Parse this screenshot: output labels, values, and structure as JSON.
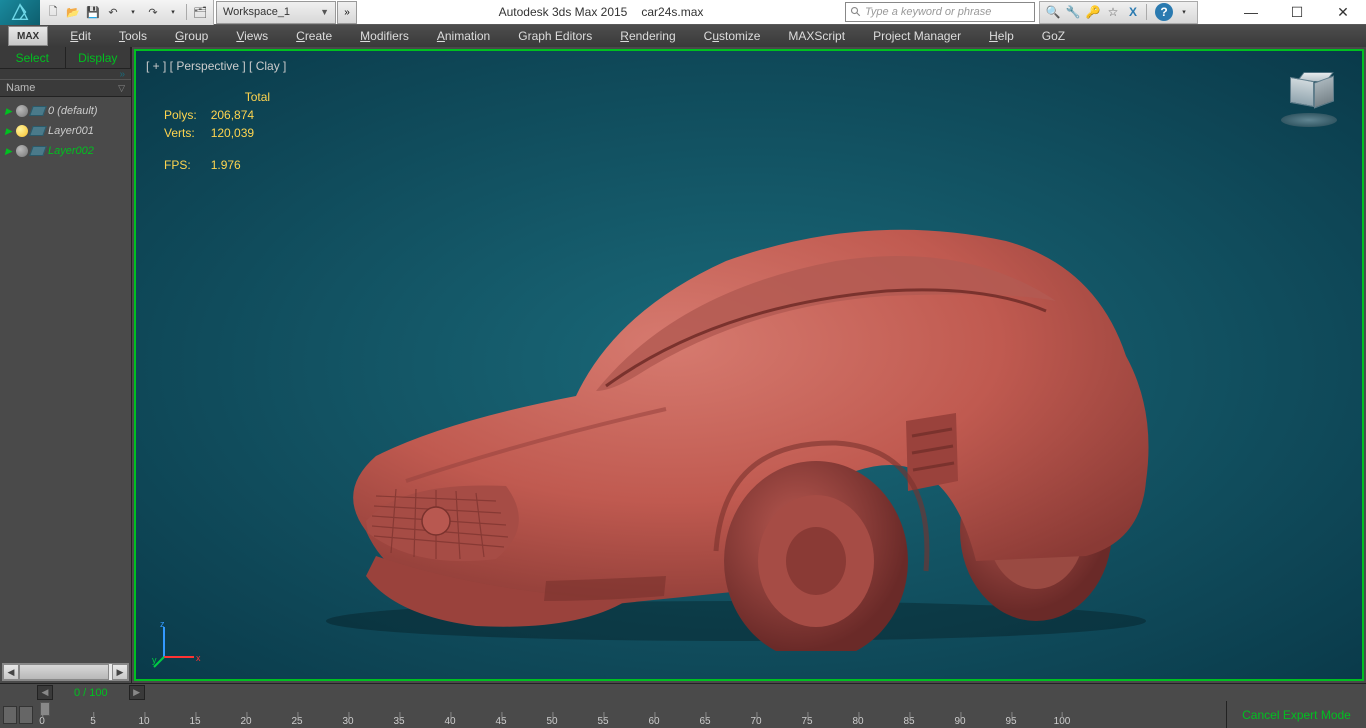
{
  "titlebar": {
    "workspace": "Workspace_1",
    "app_title": "Autodesk 3ds Max  2015",
    "filename": "car24s.max",
    "search_placeholder": "Type a keyword or phrase",
    "max_label": "MAX"
  },
  "menus": {
    "edit": "Edit",
    "tools": "Tools",
    "group": "Group",
    "views": "Views",
    "create": "Create",
    "modifiers": "Modifiers",
    "animation": "Animation",
    "graph": "Graph Editors",
    "rendering": "Rendering",
    "customize": "Customize",
    "maxscript": "MAXScript",
    "project": "Project Manager",
    "help": "Help",
    "goz": "GoZ"
  },
  "left_panel": {
    "tab_select": "Select",
    "tab_display": "Display",
    "header": "Name",
    "layers": [
      {
        "name": "0 (default)",
        "on": false,
        "active": false
      },
      {
        "name": "Layer001",
        "on": true,
        "active": false
      },
      {
        "name": "Layer002",
        "on": false,
        "active": true
      }
    ]
  },
  "viewport": {
    "label": "[ + ] [ Perspective ] [ Clay ]",
    "stats": {
      "total_hdr": "Total",
      "polys_lbl": "Polys:",
      "polys_val": "206,874",
      "verts_lbl": "Verts:",
      "verts_val": "120,039",
      "fps_lbl": "FPS:",
      "fps_val": "1.976"
    },
    "gizmo": {
      "x": "x",
      "y": "y",
      "z": "z"
    }
  },
  "timeline": {
    "frame": "0 / 100",
    "cancel": "Cancel Expert Mode",
    "ticks": [
      {
        "v": "0",
        "p": 0
      },
      {
        "v": "5",
        "p": 5
      },
      {
        "v": "10",
        "p": 10
      },
      {
        "v": "15",
        "p": 15
      },
      {
        "v": "20",
        "p": 20
      },
      {
        "v": "25",
        "p": 25
      },
      {
        "v": "30",
        "p": 30
      },
      {
        "v": "35",
        "p": 35
      },
      {
        "v": "40",
        "p": 40
      },
      {
        "v": "45",
        "p": 45
      },
      {
        "v": "50",
        "p": 50
      },
      {
        "v": "55",
        "p": 55
      },
      {
        "v": "60",
        "p": 60
      },
      {
        "v": "65",
        "p": 65
      },
      {
        "v": "70",
        "p": 70
      },
      {
        "v": "75",
        "p": 75
      },
      {
        "v": "80",
        "p": 80
      },
      {
        "v": "85",
        "p": 85
      },
      {
        "v": "90",
        "p": 90
      },
      {
        "v": "95",
        "p": 95
      },
      {
        "v": "100",
        "p": 100
      }
    ]
  }
}
